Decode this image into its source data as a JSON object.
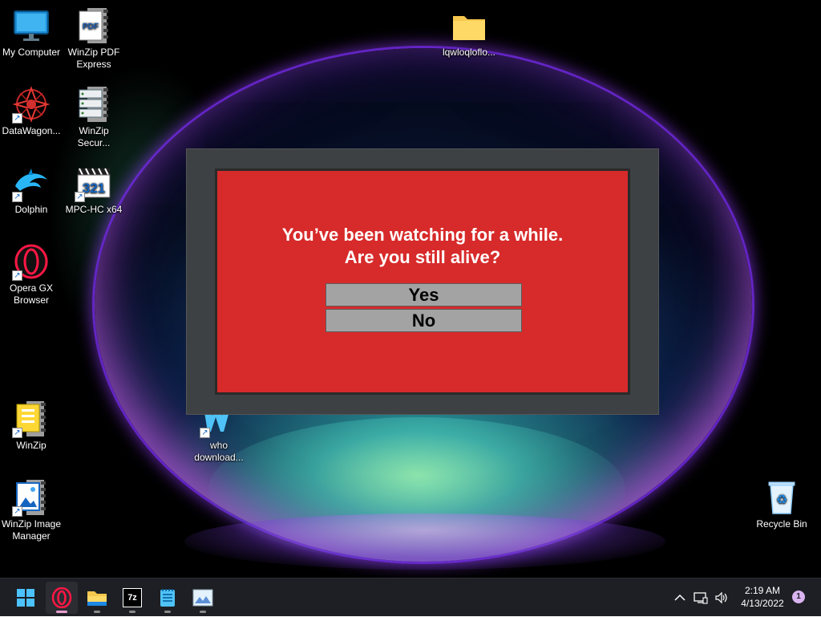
{
  "desktop": {
    "icons": [
      {
        "label": "My Computer"
      },
      {
        "label": "WinZip PDF Express"
      },
      {
        "label": "DataWagon..."
      },
      {
        "label": "WinZip Secur..."
      },
      {
        "label": "Dolphin"
      },
      {
        "label": "MPC-HC x64"
      },
      {
        "label": "Opera GX Browser"
      },
      {
        "label": "WinZip"
      },
      {
        "label": "WinZip Image Manager"
      },
      {
        "label": "lqwloqloflo..."
      },
      {
        "label": "who download..."
      },
      {
        "label": "Recycle Bin"
      }
    ],
    "pdf_badge_text": "PDF",
    "mpc_badge_text": "321"
  },
  "popup": {
    "message_line1": "You’ve been watching for a while.",
    "message_line2": "Are you still alive?",
    "yes_label": "Yes",
    "no_label": "No",
    "panel_color": "#d72a2a",
    "frame_color": "#3d4144"
  },
  "taskbar": {
    "apps": [
      {
        "name": "start-icon"
      },
      {
        "name": "opera-gx-icon",
        "active": true
      },
      {
        "name": "file-explorer-icon"
      },
      {
        "name": "7zip-icon",
        "text": "7z"
      },
      {
        "name": "notepad-icon"
      },
      {
        "name": "image-viewer-icon"
      }
    ],
    "clock_time": "2:19 AM",
    "clock_date": "4/13/2022",
    "notification_count": "1"
  }
}
